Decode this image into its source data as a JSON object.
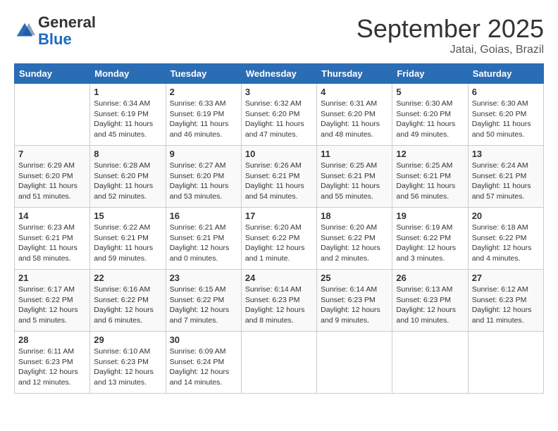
{
  "logo": {
    "general": "General",
    "blue": "Blue"
  },
  "title": "September 2025",
  "subtitle": "Jatai, Goias, Brazil",
  "days_of_week": [
    "Sunday",
    "Monday",
    "Tuesday",
    "Wednesday",
    "Thursday",
    "Friday",
    "Saturday"
  ],
  "weeks": [
    [
      {
        "day": "",
        "sunrise": "",
        "sunset": "",
        "daylight": ""
      },
      {
        "day": "1",
        "sunrise": "Sunrise: 6:34 AM",
        "sunset": "Sunset: 6:19 PM",
        "daylight": "Daylight: 11 hours and 45 minutes."
      },
      {
        "day": "2",
        "sunrise": "Sunrise: 6:33 AM",
        "sunset": "Sunset: 6:19 PM",
        "daylight": "Daylight: 11 hours and 46 minutes."
      },
      {
        "day": "3",
        "sunrise": "Sunrise: 6:32 AM",
        "sunset": "Sunset: 6:20 PM",
        "daylight": "Daylight: 11 hours and 47 minutes."
      },
      {
        "day": "4",
        "sunrise": "Sunrise: 6:31 AM",
        "sunset": "Sunset: 6:20 PM",
        "daylight": "Daylight: 11 hours and 48 minutes."
      },
      {
        "day": "5",
        "sunrise": "Sunrise: 6:30 AM",
        "sunset": "Sunset: 6:20 PM",
        "daylight": "Daylight: 11 hours and 49 minutes."
      },
      {
        "day": "6",
        "sunrise": "Sunrise: 6:30 AM",
        "sunset": "Sunset: 6:20 PM",
        "daylight": "Daylight: 11 hours and 50 minutes."
      }
    ],
    [
      {
        "day": "7",
        "sunrise": "Sunrise: 6:29 AM",
        "sunset": "Sunset: 6:20 PM",
        "daylight": "Daylight: 11 hours and 51 minutes."
      },
      {
        "day": "8",
        "sunrise": "Sunrise: 6:28 AM",
        "sunset": "Sunset: 6:20 PM",
        "daylight": "Daylight: 11 hours and 52 minutes."
      },
      {
        "day": "9",
        "sunrise": "Sunrise: 6:27 AM",
        "sunset": "Sunset: 6:20 PM",
        "daylight": "Daylight: 11 hours and 53 minutes."
      },
      {
        "day": "10",
        "sunrise": "Sunrise: 6:26 AM",
        "sunset": "Sunset: 6:21 PM",
        "daylight": "Daylight: 11 hours and 54 minutes."
      },
      {
        "day": "11",
        "sunrise": "Sunrise: 6:25 AM",
        "sunset": "Sunset: 6:21 PM",
        "daylight": "Daylight: 11 hours and 55 minutes."
      },
      {
        "day": "12",
        "sunrise": "Sunrise: 6:25 AM",
        "sunset": "Sunset: 6:21 PM",
        "daylight": "Daylight: 11 hours and 56 minutes."
      },
      {
        "day": "13",
        "sunrise": "Sunrise: 6:24 AM",
        "sunset": "Sunset: 6:21 PM",
        "daylight": "Daylight: 11 hours and 57 minutes."
      }
    ],
    [
      {
        "day": "14",
        "sunrise": "Sunrise: 6:23 AM",
        "sunset": "Sunset: 6:21 PM",
        "daylight": "Daylight: 11 hours and 58 minutes."
      },
      {
        "day": "15",
        "sunrise": "Sunrise: 6:22 AM",
        "sunset": "Sunset: 6:21 PM",
        "daylight": "Daylight: 11 hours and 59 minutes."
      },
      {
        "day": "16",
        "sunrise": "Sunrise: 6:21 AM",
        "sunset": "Sunset: 6:21 PM",
        "daylight": "Daylight: 12 hours and 0 minutes."
      },
      {
        "day": "17",
        "sunrise": "Sunrise: 6:20 AM",
        "sunset": "Sunset: 6:22 PM",
        "daylight": "Daylight: 12 hours and 1 minute."
      },
      {
        "day": "18",
        "sunrise": "Sunrise: 6:20 AM",
        "sunset": "Sunset: 6:22 PM",
        "daylight": "Daylight: 12 hours and 2 minutes."
      },
      {
        "day": "19",
        "sunrise": "Sunrise: 6:19 AM",
        "sunset": "Sunset: 6:22 PM",
        "daylight": "Daylight: 12 hours and 3 minutes."
      },
      {
        "day": "20",
        "sunrise": "Sunrise: 6:18 AM",
        "sunset": "Sunset: 6:22 PM",
        "daylight": "Daylight: 12 hours and 4 minutes."
      }
    ],
    [
      {
        "day": "21",
        "sunrise": "Sunrise: 6:17 AM",
        "sunset": "Sunset: 6:22 PM",
        "daylight": "Daylight: 12 hours and 5 minutes."
      },
      {
        "day": "22",
        "sunrise": "Sunrise: 6:16 AM",
        "sunset": "Sunset: 6:22 PM",
        "daylight": "Daylight: 12 hours and 6 minutes."
      },
      {
        "day": "23",
        "sunrise": "Sunrise: 6:15 AM",
        "sunset": "Sunset: 6:22 PM",
        "daylight": "Daylight: 12 hours and 7 minutes."
      },
      {
        "day": "24",
        "sunrise": "Sunrise: 6:14 AM",
        "sunset": "Sunset: 6:23 PM",
        "daylight": "Daylight: 12 hours and 8 minutes."
      },
      {
        "day": "25",
        "sunrise": "Sunrise: 6:14 AM",
        "sunset": "Sunset: 6:23 PM",
        "daylight": "Daylight: 12 hours and 9 minutes."
      },
      {
        "day": "26",
        "sunrise": "Sunrise: 6:13 AM",
        "sunset": "Sunset: 6:23 PM",
        "daylight": "Daylight: 12 hours and 10 minutes."
      },
      {
        "day": "27",
        "sunrise": "Sunrise: 6:12 AM",
        "sunset": "Sunset: 6:23 PM",
        "daylight": "Daylight: 12 hours and 11 minutes."
      }
    ],
    [
      {
        "day": "28",
        "sunrise": "Sunrise: 6:11 AM",
        "sunset": "Sunset: 6:23 PM",
        "daylight": "Daylight: 12 hours and 12 minutes."
      },
      {
        "day": "29",
        "sunrise": "Sunrise: 6:10 AM",
        "sunset": "Sunset: 6:23 PM",
        "daylight": "Daylight: 12 hours and 13 minutes."
      },
      {
        "day": "30",
        "sunrise": "Sunrise: 6:09 AM",
        "sunset": "Sunset: 6:24 PM",
        "daylight": "Daylight: 12 hours and 14 minutes."
      },
      {
        "day": "",
        "sunrise": "",
        "sunset": "",
        "daylight": ""
      },
      {
        "day": "",
        "sunrise": "",
        "sunset": "",
        "daylight": ""
      },
      {
        "day": "",
        "sunrise": "",
        "sunset": "",
        "daylight": ""
      },
      {
        "day": "",
        "sunrise": "",
        "sunset": "",
        "daylight": ""
      }
    ]
  ]
}
